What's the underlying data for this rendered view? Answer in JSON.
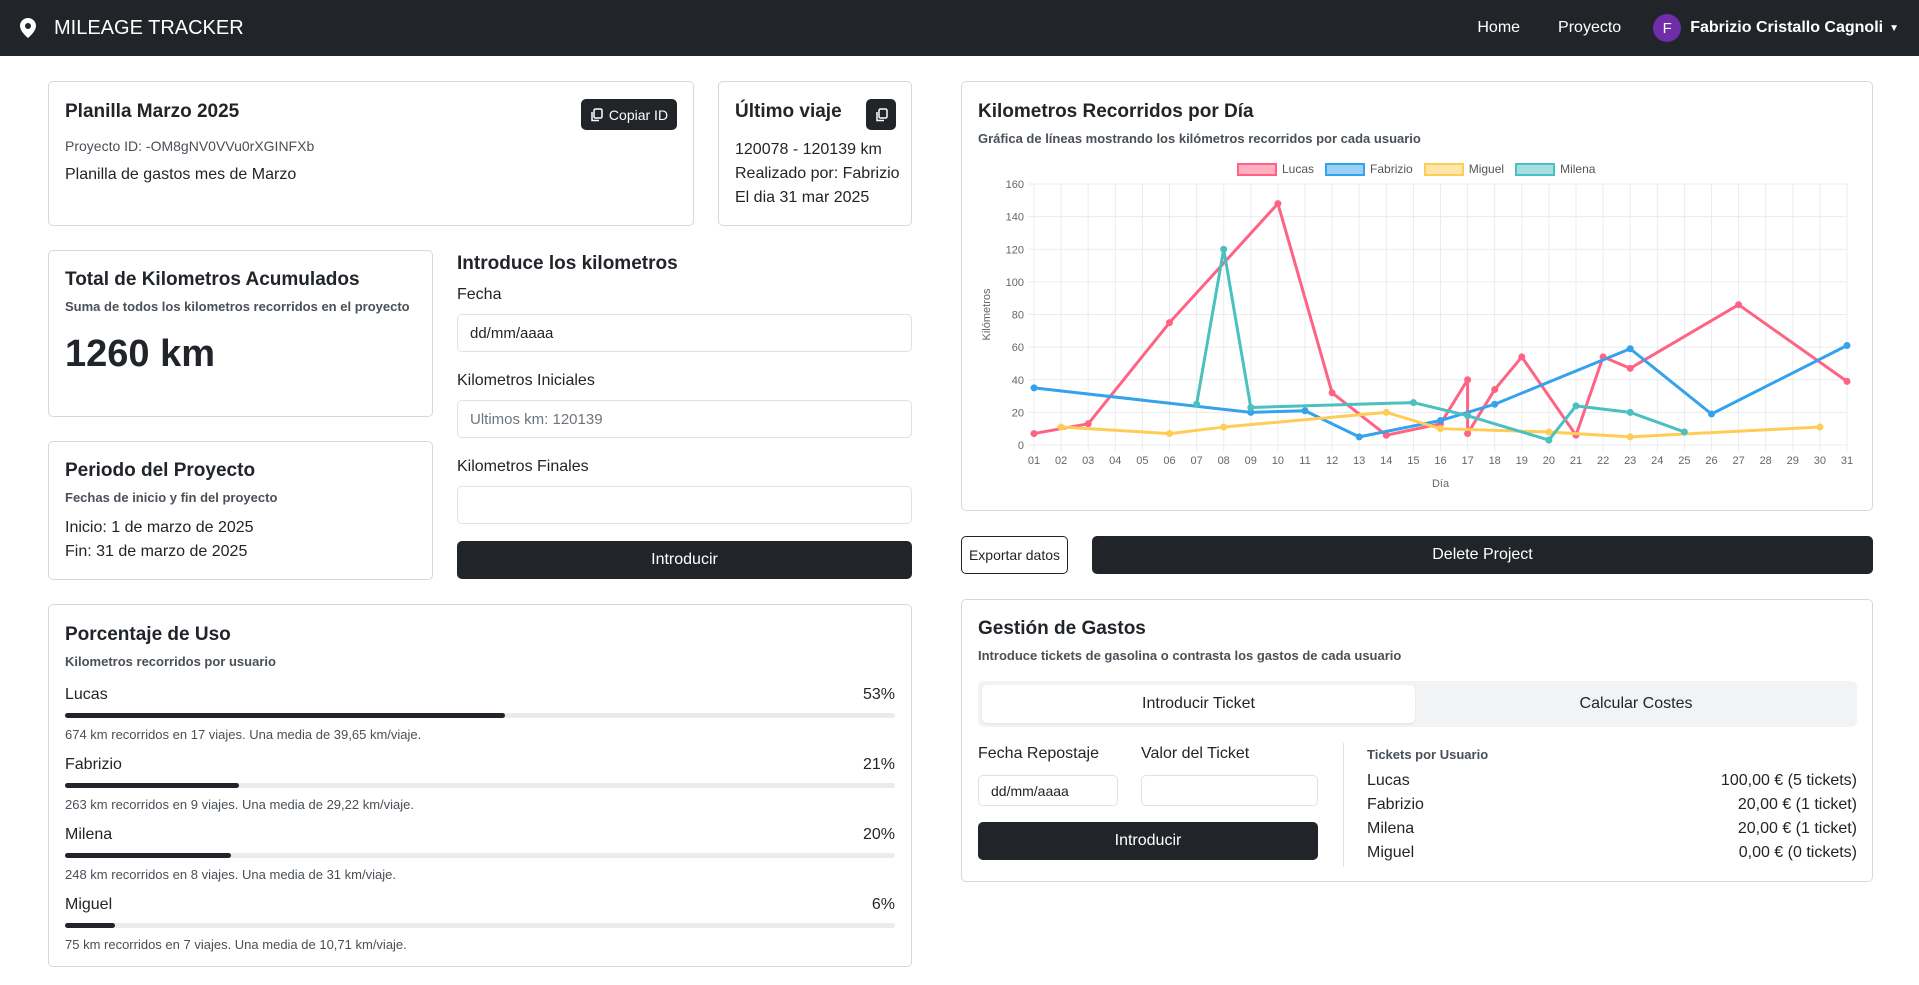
{
  "app": {
    "brand": "MILEAGE TRACKER"
  },
  "nav": {
    "home": "Home",
    "project": "Proyecto",
    "user_initial": "F",
    "user_name": "Fabrizio Cristallo Cagnoli"
  },
  "planilla": {
    "title": "Planilla Marzo 2025",
    "copy_label": "Copiar ID",
    "project_id": "Proyecto ID: -OM8gNV0VVu0rXGINFXb",
    "description": "Planilla de gastos mes de Marzo"
  },
  "ultimo": {
    "title": "Último viaje",
    "range": "120078 - 120139 km",
    "by": "Realizado por: Fabrizio",
    "date": "El dia 31 mar 2025"
  },
  "total": {
    "title": "Total de Kilometros Acumulados",
    "subtitle": "Suma de todos los kilometros recorridos en el proyecto",
    "value": "1260 km"
  },
  "periodo": {
    "title": "Periodo del Proyecto",
    "subtitle": "Fechas de inicio y fin del proyecto",
    "start": "Inicio: 1 de marzo de 2025",
    "end": "Fin: 31 de marzo de 2025"
  },
  "km_form": {
    "title": "Introduce los kilometros",
    "date_label": "Fecha",
    "date_value": "dd/mm/aaaa",
    "start_label": "Kilometros Iniciales",
    "start_placeholder": "Ultimos km: 120139",
    "end_label": "Kilometros Finales",
    "end_placeholder": "",
    "submit": "Introducir"
  },
  "uso": {
    "title": "Porcentaje de Uso",
    "subtitle": "Kilometros recorridos por usuario",
    "users": [
      {
        "name": "Lucas",
        "percent_label": "53%",
        "fraction": 0.53,
        "detail": "674 km recorridos en 17 viajes. Una media de 39,65 km/viaje."
      },
      {
        "name": "Fabrizio",
        "percent_label": "21%",
        "fraction": 0.21,
        "detail": "263 km recorridos en 9 viajes. Una media de 29,22 km/viaje."
      },
      {
        "name": "Milena",
        "percent_label": "20%",
        "fraction": 0.2,
        "detail": "248 km recorridos en 8 viajes. Una media de 31 km/viaje."
      },
      {
        "name": "Miguel",
        "percent_label": "6%",
        "fraction": 0.06,
        "detail": "75 km recorridos en 7 viajes. Una media de 10,71 km/viaje."
      }
    ]
  },
  "chart_card": {
    "title": "Kilometros Recorridos por Día",
    "subtitle": "Gráfica de líneas mostrando los kilómetros recorridos por cada usuario"
  },
  "actions": {
    "export": "Exportar datos",
    "delete": "Delete Project"
  },
  "gastos": {
    "title": "Gestión de Gastos",
    "subtitle": "Introduce tickets de gasolina o contrasta los gastos de cada usuario",
    "tab_ticket": "Introducir Ticket",
    "tab_costs": "Calcular Costes",
    "fecha_label": "Fecha Repostaje",
    "fecha_value": "dd/mm/aaaa",
    "valor_label": "Valor del Ticket",
    "valor_placeholder": "",
    "submit": "Introducir",
    "tickets_title": "Tickets por Usuario",
    "tickets": [
      {
        "name": "Lucas",
        "amount": "100,00 € (5 tickets)"
      },
      {
        "name": "Fabrizio",
        "amount": "20,00 € (1 ticket)"
      },
      {
        "name": "Milena",
        "amount": "20,00 € (1 ticket)"
      },
      {
        "name": "Miguel",
        "amount": "0,00 € (0 tickets)"
      }
    ]
  },
  "chart_data": {
    "type": "line",
    "title": "",
    "xlabel": "Día",
    "ylabel": "Kilómetros",
    "ylim": [
      0,
      160
    ],
    "yticks": [
      0,
      20,
      40,
      60,
      80,
      100,
      120,
      140,
      160
    ],
    "grid": true,
    "legend": "top-center",
    "categories": [
      "01",
      "02",
      "03",
      "04",
      "05",
      "06",
      "07",
      "08",
      "09",
      "10",
      "11",
      "12",
      "13",
      "14",
      "15",
      "16",
      "17",
      "18",
      "19",
      "20",
      "21",
      "22",
      "23",
      "24",
      "25",
      "26",
      "27",
      "28",
      "29",
      "30",
      "31"
    ],
    "series": [
      {
        "name": "Lucas",
        "color": "#ff6384",
        "points": [
          [
            1,
            7
          ],
          [
            3,
            13
          ],
          [
            6,
            75
          ],
          [
            10,
            148
          ],
          [
            12,
            32
          ],
          [
            14,
            6
          ],
          [
            16,
            13
          ],
          [
            17,
            40
          ],
          [
            17,
            7
          ],
          [
            18,
            34
          ],
          [
            19,
            54
          ],
          [
            21,
            6
          ],
          [
            22,
            54
          ],
          [
            23,
            47
          ],
          [
            27,
            86
          ],
          [
            31,
            39
          ]
        ]
      },
      {
        "name": "Fabrizio",
        "color": "#36a2eb",
        "points": [
          [
            1,
            35
          ],
          [
            9,
            20
          ],
          [
            11,
            21
          ],
          [
            13,
            5
          ],
          [
            16,
            15
          ],
          [
            18,
            25
          ],
          [
            23,
            59
          ],
          [
            26,
            19
          ],
          [
            31,
            61
          ]
        ]
      },
      {
        "name": "Miguel",
        "color": "#ffcd56",
        "points": [
          [
            2,
            11
          ],
          [
            6,
            7
          ],
          [
            8,
            11
          ],
          [
            14,
            20
          ],
          [
            16,
            10
          ],
          [
            20,
            8
          ],
          [
            23,
            5
          ],
          [
            30,
            11
          ]
        ]
      },
      {
        "name": "Milena",
        "color": "#4bc0c0",
        "points": [
          [
            7,
            25
          ],
          [
            8,
            120
          ],
          [
            9,
            23
          ],
          [
            15,
            26
          ],
          [
            17,
            18
          ],
          [
            20,
            3
          ],
          [
            21,
            24
          ],
          [
            23,
            20
          ],
          [
            25,
            8
          ]
        ]
      }
    ]
  }
}
